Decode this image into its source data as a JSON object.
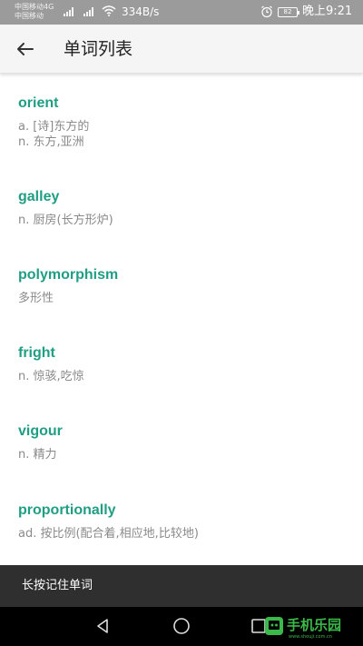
{
  "status_bar": {
    "carrier_1": "中国移动4G",
    "carrier_2": "中国移动",
    "speed": "334B/s",
    "battery": "82",
    "time": "晚上9:21"
  },
  "header": {
    "title": "单词列表",
    "back_icon": "arrow-left-icon"
  },
  "words": [
    {
      "word": "orient",
      "meaning": "a. [诗]东方的\nn. 东方,亚洲"
    },
    {
      "word": "galley",
      "meaning": "n. 厨房(长方形炉)"
    },
    {
      "word": "polymorphism",
      "meaning": "多形性"
    },
    {
      "word": "fright",
      "meaning": "n. 惊骇,吃惊"
    },
    {
      "word": "vigour",
      "meaning": "n. 精力"
    },
    {
      "word": "proportionally",
      "meaning": "ad. 按比例(配合着,相应地,比较地)"
    }
  ],
  "tip": "长按记住单词",
  "watermark": {
    "title": "手机乐园",
    "url": "www.shouji.com.cn"
  },
  "colors": {
    "accent": "#1f9e84",
    "meaning_text": "#8a8a8a",
    "status_bar": "#9b9b9b",
    "app_bar": "#f5f5f5",
    "tip_bar": "#2f2f2f",
    "watermark_green": "#3bb84a"
  }
}
